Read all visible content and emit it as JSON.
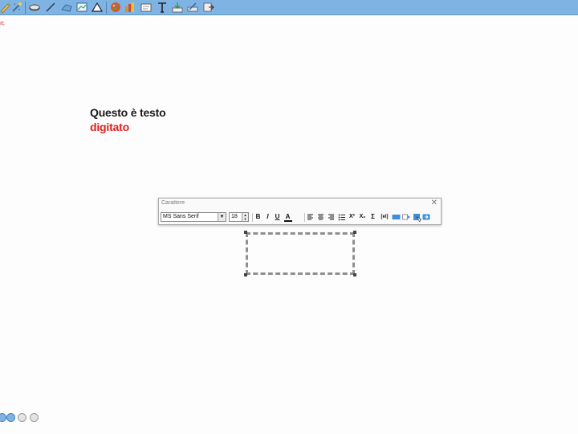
{
  "toolbar": {
    "icons": [
      "pencil-icon",
      "magic-wand-icon",
      "eraser-icon",
      "line-icon",
      "shape-icon",
      "graph-icon",
      "triangle-icon",
      "palette-icon",
      "bar-chart-icon",
      "textbox-icon",
      "text-tool-icon",
      "image-import-icon",
      "ruler-edit-icon",
      "export-icon"
    ],
    "colors": {
      "bar": "#7fb3e3",
      "accent": "#e0201c"
    }
  },
  "corner_label": "ıt;",
  "canvas": {
    "line1": "Questo è testo",
    "line2": "digitato"
  },
  "font_dialog": {
    "title": "Carattere",
    "close": "✕",
    "font_name": "MS Sans Serif",
    "font_size": "18",
    "buttons": {
      "bold": "B",
      "italic": "I",
      "underline": "U",
      "color": "A",
      "superscript": "X²",
      "subscript": "X₂",
      "sum": "Σ",
      "code": "[el]"
    }
  }
}
